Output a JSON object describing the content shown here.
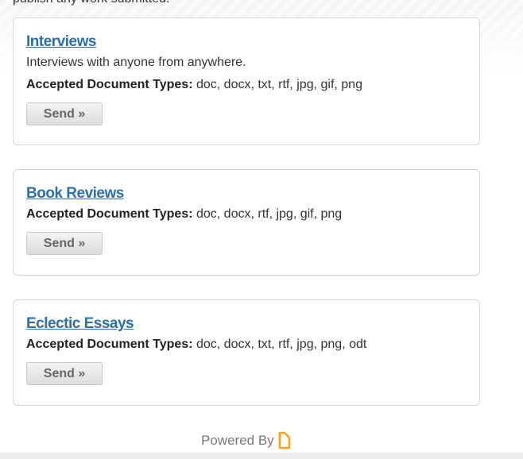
{
  "header": {
    "intro_text": "publish any work submitted."
  },
  "categories": [
    {
      "title": "Interviews",
      "description": "Interviews with anyone from anywhere.",
      "types_label": "Accepted Document Types:",
      "types_value": "doc, docx, txt, rtf, jpg, gif, png",
      "button_label": "Send »"
    },
    {
      "title": "Book Reviews",
      "description": "",
      "types_label": "Accepted Document Types:",
      "types_value": "doc, docx, rtf, jpg, gif, png",
      "button_label": "Send »"
    },
    {
      "title": "Eclectic Essays",
      "description": "",
      "types_label": "Accepted Document Types:",
      "types_value": "doc, docx, txt, rtf, jpg, png, odt",
      "button_label": "Send »"
    }
  ],
  "footer": {
    "powered_by": "Powered By",
    "logo_icon": "submittable-logo-icon",
    "logo_color": "#f5a623"
  }
}
